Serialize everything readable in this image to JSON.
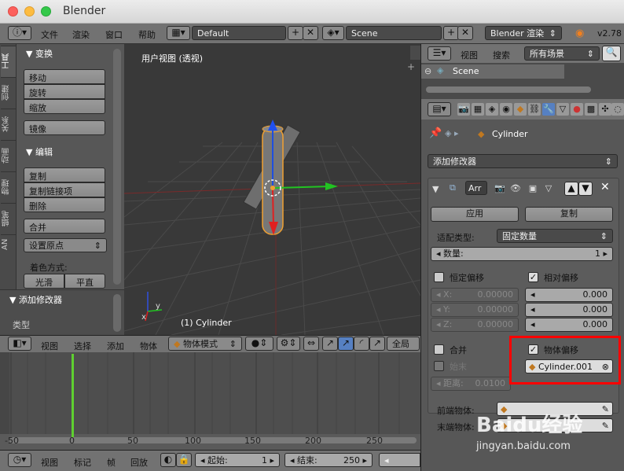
{
  "window": {
    "title": "Blender"
  },
  "menubar": {
    "info_icon": "info-icon",
    "menus": [
      "文件",
      "渲染",
      "窗口",
      "帮助"
    ],
    "layout": "Default",
    "scene": "Scene",
    "engine": "Blender 渲染",
    "version": "v2.78"
  },
  "toolshelf": {
    "tabs": [
      "工具",
      "创建",
      "关系",
      "动画",
      "物理",
      "蜡笔",
      "AN"
    ],
    "transform_header": "▼ 变换",
    "transform_buttons": [
      "移动",
      "旋转",
      "缩放"
    ],
    "mirror": "镜像",
    "edit_header": "▼ 编辑",
    "edit_buttons": [
      "复制",
      "复制链接项",
      "删除"
    ],
    "join": "合并",
    "set_origin": "设置原点",
    "shading_label": "着色方式:",
    "smooth": "光滑",
    "flat": "平直",
    "add_modifier_header": "▼ 添加修改器",
    "type_label": "类型"
  },
  "viewport": {
    "title": "用户视图 (透视)",
    "object_label": "(1) Cylinder",
    "axis_x": "x",
    "axis_y": "y"
  },
  "view_header": {
    "menus": [
      "视图",
      "选择",
      "添加",
      "物体"
    ],
    "mode": "物体模式",
    "global": "全局"
  },
  "timeline": {
    "ticks": [
      "-50",
      "0",
      "50",
      "100",
      "150",
      "200",
      "250"
    ],
    "current_frame": 0
  },
  "timeline_bar": {
    "menus": [
      "视图",
      "标记",
      "帧",
      "回放"
    ],
    "start_label": "起始:",
    "start_value": "1",
    "end_label": "结束:",
    "end_value": "250"
  },
  "outliner": {
    "menus": [
      "视图",
      "搜索"
    ],
    "filter": "所有场景",
    "scene_item": "Scene"
  },
  "properties": {
    "breadcrumb_object": "Cylinder",
    "add_modifier": "添加修改器",
    "modifier_name": "Arr",
    "apply": "应用",
    "copy": "复制",
    "fit_type_label": "适配类型:",
    "fit_type_value": "固定数量",
    "count_label": "数量:",
    "count_value": "1",
    "constant_offset": "恒定偏移",
    "relative_offset": "相对偏移",
    "const_x_label": "X:",
    "const_x": "0.00000",
    "const_y_label": "Y:",
    "const_y": "0.00000",
    "const_z_label": "Z:",
    "const_z": "0.00000",
    "rel_x": "0.000",
    "rel_y": "0.000",
    "rel_z": "0.000",
    "merge": "合并",
    "object_offset": "物体偏移",
    "first_last": "始末",
    "offset_object": "Cylinder.001",
    "distance_label": "距离:",
    "distance_value": "0.0100",
    "start_cap_label": "前端物体:",
    "end_cap_label": "末端物体:"
  },
  "watermark": {
    "text": "Baidu经验",
    "url": "jingyan.baidu.com"
  },
  "colors": {
    "highlight_box": "#ff0000",
    "accent_blue": "#5680c2",
    "selection_orange": "#f0a030"
  }
}
